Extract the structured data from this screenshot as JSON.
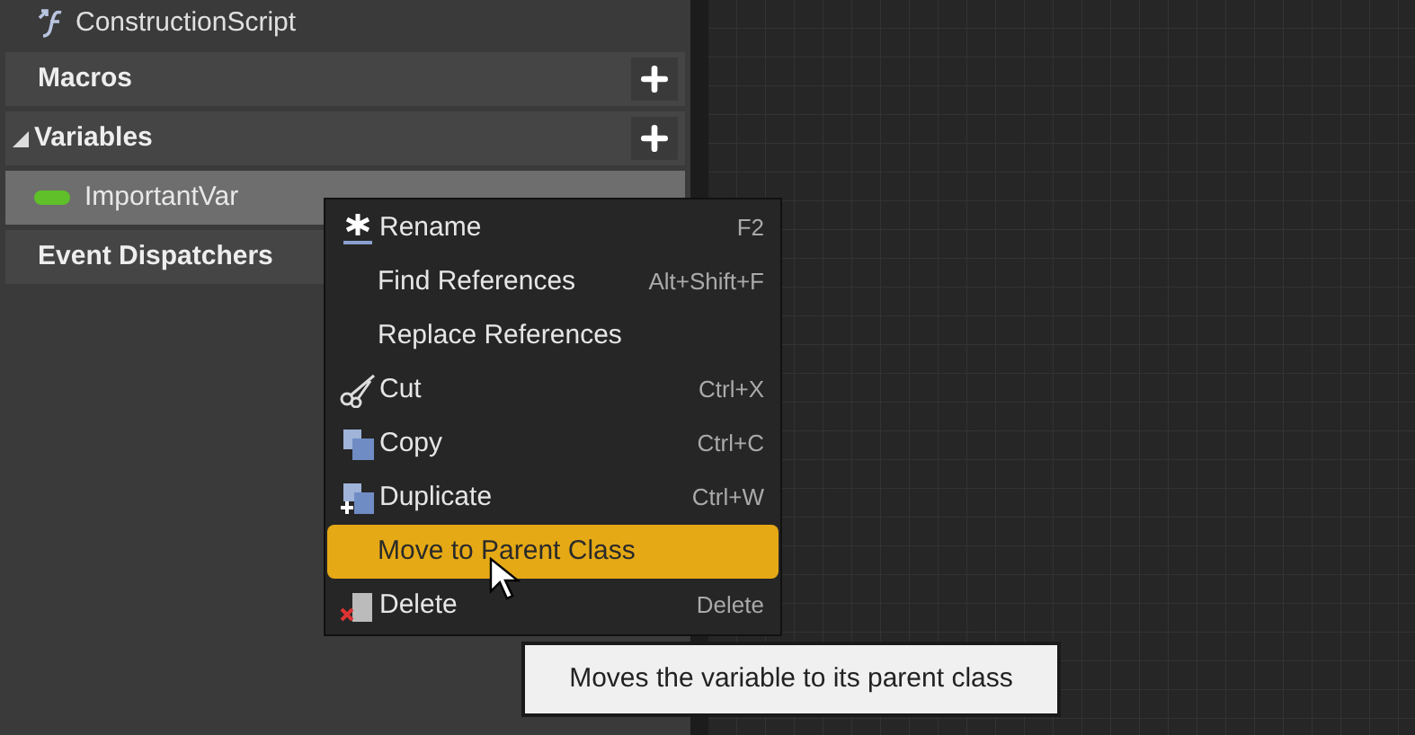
{
  "sidebar": {
    "items": [
      {
        "kind": "function",
        "label": "ConstructionScript"
      },
      {
        "kind": "category",
        "label": "Macros",
        "expanded": false
      },
      {
        "kind": "category",
        "label": "Variables",
        "expanded": true
      },
      {
        "kind": "variable",
        "label": "ImportantVar",
        "selected": true
      },
      {
        "kind": "category",
        "label": "Event Dispatchers",
        "expanded": false
      }
    ]
  },
  "context_menu": {
    "items": [
      {
        "label": "Rename",
        "shortcut": "F2",
        "selected": false
      },
      {
        "label": "Find References",
        "shortcut": "Alt+Shift+F",
        "selected": false
      },
      {
        "label": "Replace References",
        "selected": false
      },
      {
        "label": "Cut",
        "shortcut": "Ctrl+X",
        "selected": false
      },
      {
        "label": "Copy",
        "shortcut": "Ctrl+C",
        "selected": false
      },
      {
        "label": "Duplicate",
        "shortcut": "Ctrl+W",
        "selected": false
      },
      {
        "label": "Move to Parent Class",
        "selected": true
      },
      {
        "label": "Delete",
        "shortcut": "Delete",
        "selected": false
      }
    ]
  },
  "tooltip": "Moves the variable to its parent class"
}
